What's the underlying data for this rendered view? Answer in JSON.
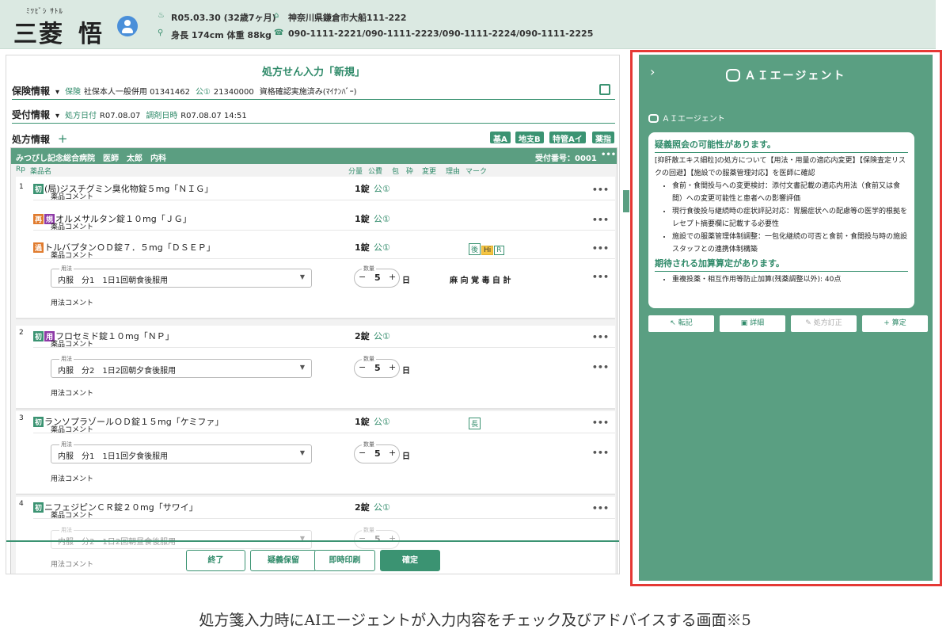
{
  "patient": {
    "kana": "ﾐﾂﾋﾞｼ ｻﾄﾙ",
    "name_last": "三菱",
    "name_first": "悟",
    "birth": "R05.03.30 (32歳7ヶ月)",
    "body": "身長 174cm 体重 88kg",
    "address": "神奈川県鎌倉市大船111-222",
    "phone": "090-1111-2221/090-1111-2223/090-1111-2224/090-1111-2225"
  },
  "form": {
    "title": "処方せん入力「新規」",
    "insurance_label": "保険情報",
    "insurance_kind_label": "保険",
    "insurance_kind": "社保本人一般併用 01341462",
    "public_label": "公①",
    "public_no": "21340000",
    "insurance_status": "資格確認実施済み(ﾏｲﾅﾝﾊﾞｰ)",
    "reception_label": "受付情報",
    "rx_date_label": "処方日付",
    "rx_date": "R07.08.07",
    "dispense_label": "調剤日時",
    "dispense_date": "R07.08.07 14:51",
    "rx_info_label": "処方情報",
    "tags": [
      "基A",
      "地支B",
      "特管Aイ",
      "薬指"
    ],
    "hospital": "みつびし記念総合病院　医師　太郎　内科",
    "reception_no": "受付番号：0001",
    "col_headers": [
      "Rp",
      "薬品名",
      "分量",
      "公費",
      "包",
      "砕",
      "変更",
      "理由",
      "マーク"
    ],
    "drug_comment": "薬品コメント",
    "usage_label": "用法",
    "usage_comment": "用法コメント",
    "qty_label": "数量",
    "day_unit": "日",
    "rps": [
      {
        "no": "1",
        "drugs": [
          {
            "badges": [
              "初"
            ],
            "name": "(局)ジスチグミン臭化物錠５mg「ＮＩＧ」",
            "dose": "1錠",
            "pub": "公①",
            "marks": []
          },
          {
            "badges": [
              "再",
              "規"
            ],
            "name": "オルメサルタン錠１０mg「ＪＧ」",
            "dose": "1錠",
            "pub": "公①",
            "marks": []
          },
          {
            "badges": [
              "過"
            ],
            "name": "トルバプタンＯＤ錠７．５mg「ＤＳＥＰ」",
            "dose": "1錠",
            "pub": "公①",
            "marks": [
              "後",
              "Hi",
              "R"
            ]
          }
        ],
        "usage": "内服　分1　1日1回朝食後服用",
        "qty": "5",
        "flags": "麻 向 覚 毒 自 計"
      },
      {
        "no": "2",
        "drugs": [
          {
            "badges": [
              "初",
              "用"
            ],
            "name": "フロセミド錠１０mg「ＮＰ」",
            "dose": "2錠",
            "pub": "公①",
            "marks": []
          }
        ],
        "usage": "内服　分2　1日2回朝夕食後服用",
        "qty": "5",
        "flags": ""
      },
      {
        "no": "3",
        "drugs": [
          {
            "badges": [
              "初"
            ],
            "name": "ランソプラゾールＯＤ錠１５mg「ケミファ」",
            "dose": "1錠",
            "pub": "公①",
            "marks": [
              "長"
            ]
          }
        ],
        "usage": "内服　分1　1日1回夕食後服用",
        "qty": "5",
        "flags": ""
      },
      {
        "no": "4",
        "drugs": [
          {
            "badges": [
              "初"
            ],
            "name": "ニフェジピンＣＲ錠２０mg「サワイ」",
            "dose": "2錠",
            "pub": "公①",
            "marks": []
          }
        ],
        "usage": "内服　分2　1日2回朝昼食後服用",
        "qty": "5",
        "flags": ""
      }
    ],
    "buttons": {
      "end": "終了",
      "hold": "疑義保留",
      "print": "即時印刷",
      "confirm": "確定"
    }
  },
  "agent": {
    "panel_title": "ＡＩエージェント",
    "sender": "ＡＩエージェント",
    "heading1": "疑義照会の可能性があります。",
    "intro": "[抑肝散エキス細粒]の処方について【用法・用量の適応内変更】【保険査定リスクの回避】【施設での服薬管理対応】を医師に確認",
    "bullets": [
      "食前・食間投与への変更検討：添付文書記載の適応内用法（食前又は食間）への変更可能性と患者への影響評価",
      "現行食後投与継続時の症状評記対応：胃腸症状への配慮等の医学的根拠をレセプト摘要欄に記載する必要性",
      "施設での服薬管理体制調整：一包化継続の可否と食前・食間投与時の施設スタッフとの連携体制構築"
    ],
    "heading2": "期待される加算算定があります。",
    "bullets2": [
      "重複投薬・相互作用等防止加算(残薬調整以外): 40点"
    ],
    "actions": [
      {
        "label": "転記",
        "icon": "arrow-icon"
      },
      {
        "label": "詳細",
        "icon": "book-icon"
      },
      {
        "label": "処方訂正",
        "icon": "pen-icon"
      },
      {
        "label": "算定",
        "icon": "plus-icon"
      }
    ]
  },
  "caption": "処方箋入力時にAIエージェントが入力内容をチェック及びアドバイスする画面※5",
  "colors": {
    "accent": "#3b9372",
    "header_bg": "#dbe9e2",
    "agent_bg": "#5a9f82",
    "highlight_border": "#e53935"
  }
}
